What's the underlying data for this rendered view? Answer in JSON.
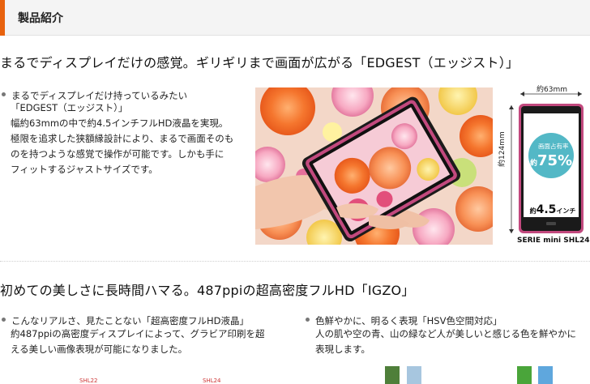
{
  "section_header": {
    "title": "製品紹介"
  },
  "feature1": {
    "headline": "まるでディスプレイだけの感覚。ギリギリまで画面が広がる「EDGEST（エッジスト）」",
    "bullet_title": "まるでディスプレイだけ持っているみたい",
    "bullet_title2": "「EDGEST（エッジスト）」",
    "lines": [
      "幅約63mmの中で約4.5インチフルHD液晶を実現。",
      "極限を追求した狭額縁設計により、まるで画面そのも",
      "のを持つような感覚で操作が可能です。しかも手に",
      "フィットするジャストサイズです。"
    ]
  },
  "spec": {
    "width_label": "約63mm",
    "height_label": "約124mm",
    "ratio_label": "画面占有率",
    "ratio_prefix": "約",
    "ratio_value": "75%",
    "size_prefix": "約",
    "size_value": "4.5",
    "size_unit": "インチ",
    "model": "SERIE mini SHL24"
  },
  "feature2": {
    "headline": "初めての美しさに長時間ハマる。487ppiの超高密度フルHD「IGZO」",
    "left": {
      "bullet_title": "こんなリアルさ、見たことない「超高密度フルHD液晶」",
      "lines": [
        "約487ppiの高密度ディスプレイによって、グラビア印刷を超",
        "える美しい画像表現が可能になりました。"
      ]
    },
    "right": {
      "bullet_title": "色鮮やかに、明るく表現「HSV色空間対応」",
      "lines": [
        "人の肌や空の青、山の緑など人が美しいと感じる色を鮮やかに",
        "表現します。"
      ]
    },
    "cutoff_labels": [
      "SHL22",
      "SHL24"
    ]
  },
  "colors": {
    "accent": "#e8620e",
    "phone_body": "#c2497e",
    "ratio_circle": "#53b8c6",
    "swatch_green_dark": "#4f7f3a",
    "swatch_blue_light": "#a7c6df",
    "swatch_green": "#4aa53a",
    "swatch_blue": "#5fa7dd"
  }
}
